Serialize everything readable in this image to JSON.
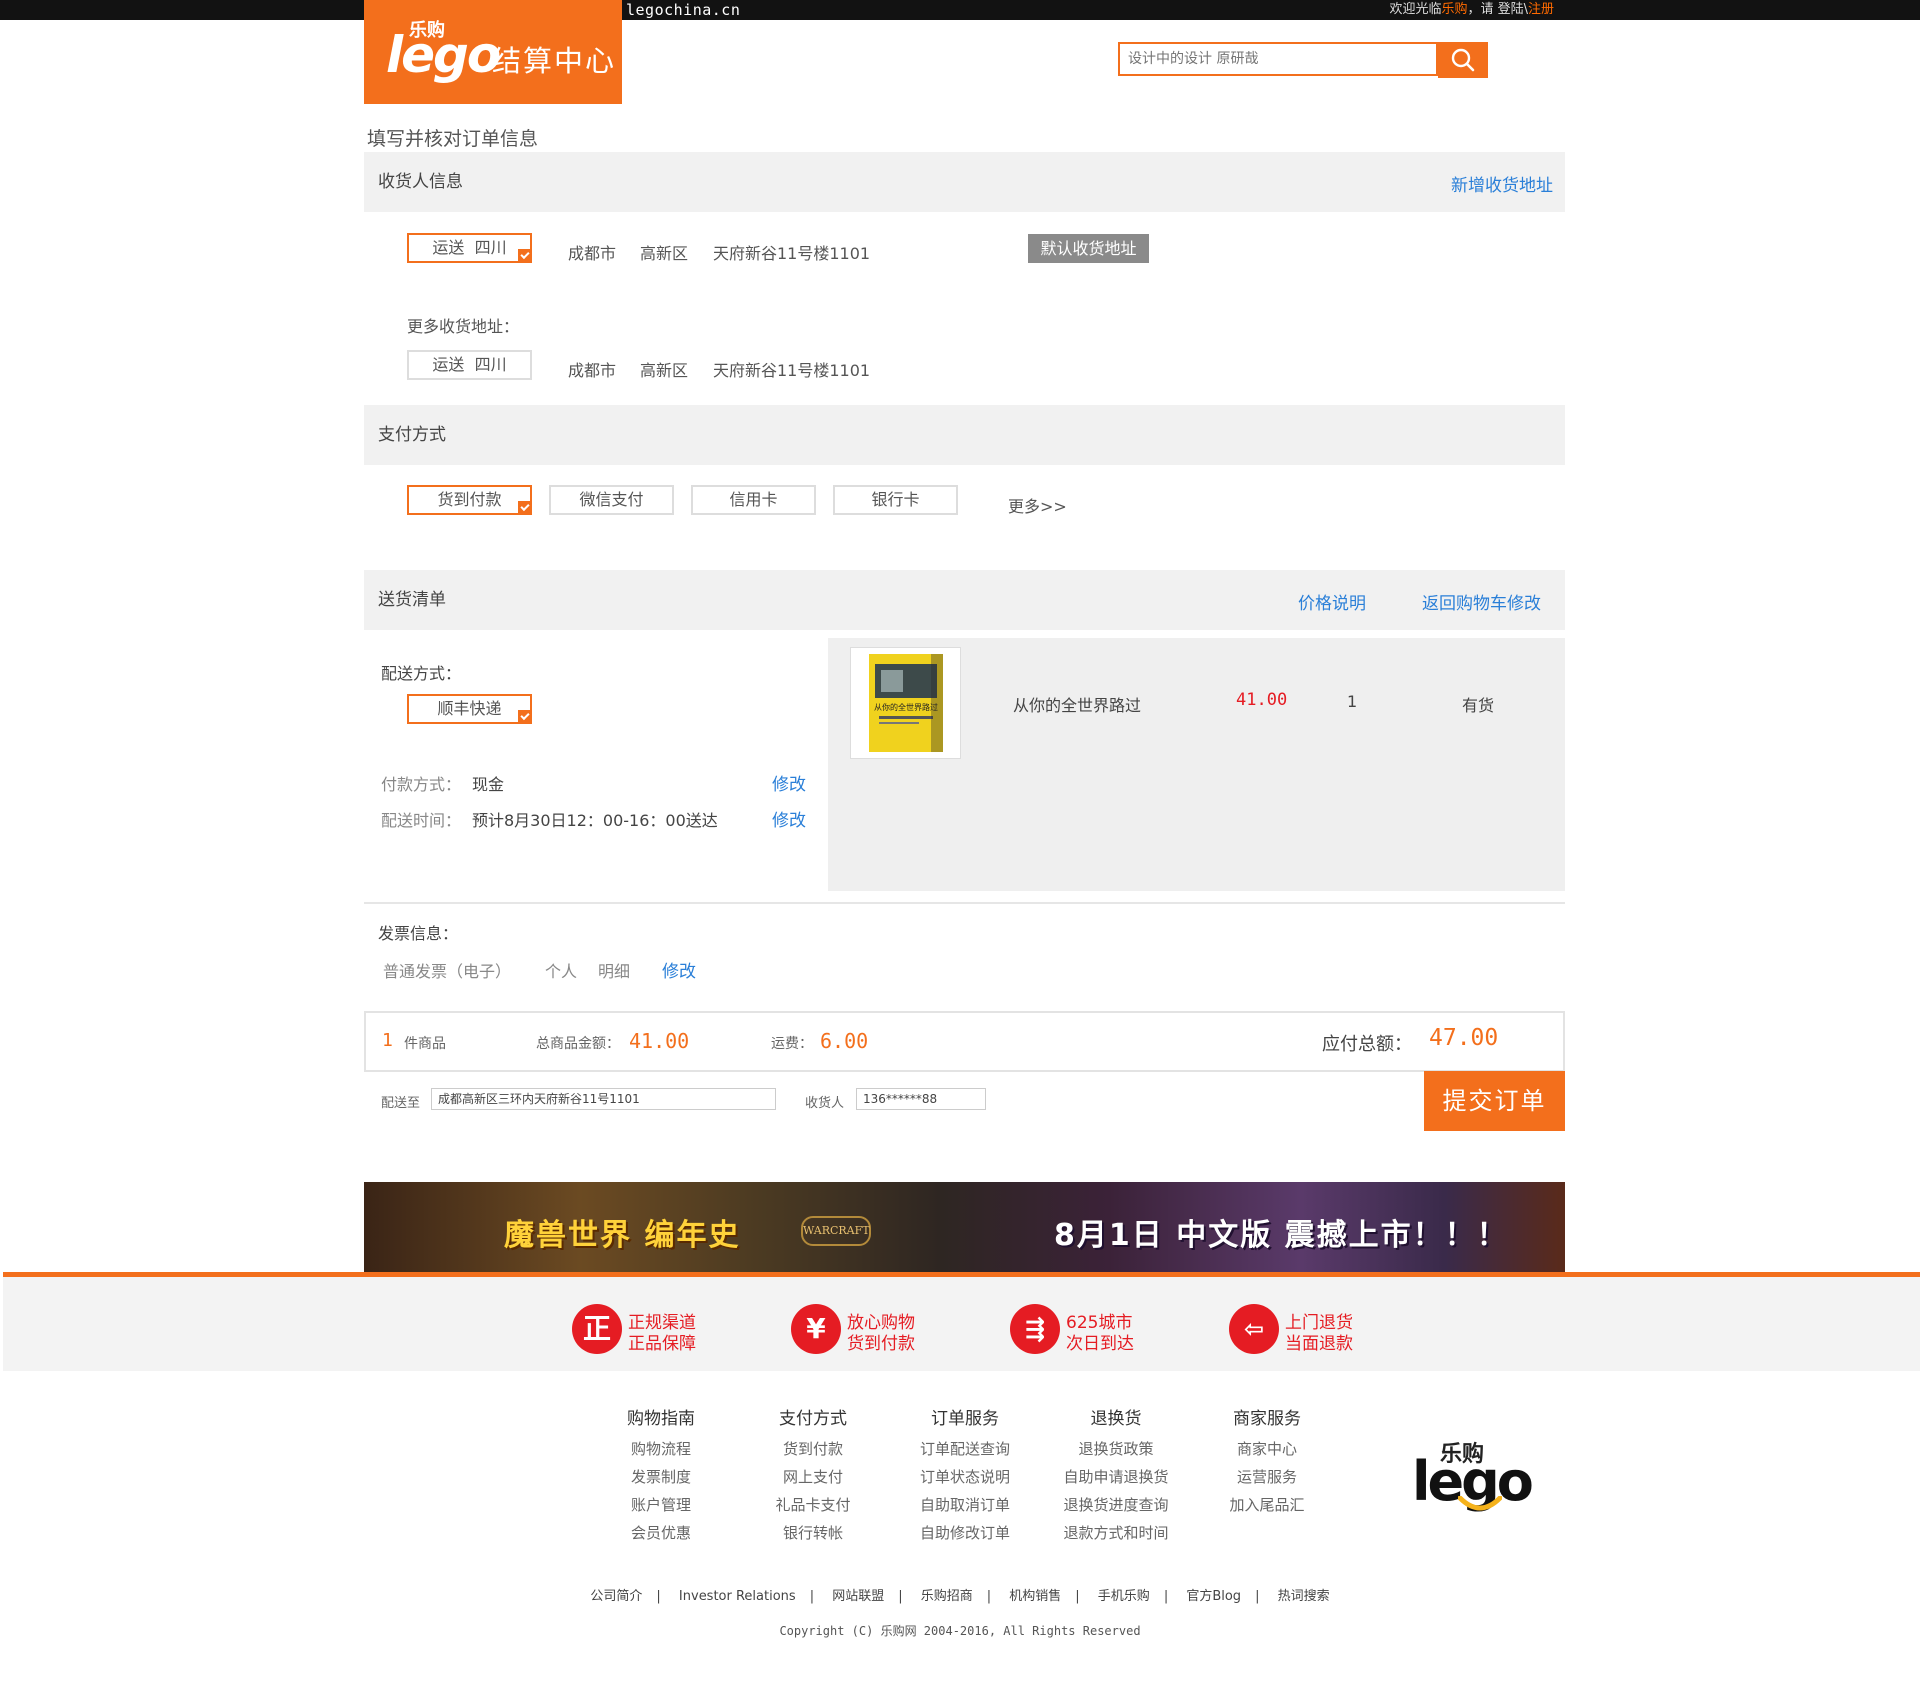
{
  "topbar": {
    "domain": "legochina.cn",
    "welcome_prefix": "欢迎光临",
    "brand": "乐购",
    "welcome_mid": "，请 登陆\\",
    "register": "注册"
  },
  "logo": {
    "legou": "乐购",
    "lego": "lego",
    "title": "结算中心"
  },
  "search": {
    "placeholder": "设计中的设计 原研哉",
    "icon": "search-icon"
  },
  "page_title": "填写并核对订单信息",
  "receiver": {
    "title": "收货人信息",
    "add_link": "新增收货地址",
    "default": {
      "chip": "运送  四川",
      "city": "成都市",
      "district": "高新区",
      "street": "天府新谷11号楼1101",
      "badge": "默认收货地址"
    },
    "more_label": "更多收货地址：",
    "more": {
      "chip": "运送  四川",
      "city": "成都市",
      "district": "高新区",
      "street": "天府新谷11号楼1101"
    }
  },
  "payment": {
    "title": "支付方式",
    "options": [
      "货到付款",
      "微信支付",
      "信用卡",
      "银行卡"
    ],
    "selected": "货到付款",
    "more": "更多>>"
  },
  "delivery": {
    "title": "送货清单",
    "price_note": "价格说明",
    "back_to_cart": "返回购物车修改",
    "method_label": "配送方式：",
    "method": "顺丰快递",
    "pay_label": "付款方式：",
    "pay_value": "现金",
    "time_label": "配送时间：",
    "time_value": "预计8月30日12：00-16：00送达",
    "modify": "修改",
    "item": {
      "cover_title": "从你的全世界路过",
      "name": "从你的全世界路过",
      "price": "41.00",
      "qty": "1",
      "stock": "有货"
    }
  },
  "invoice": {
    "label": "发票信息：",
    "type": "普通发票（电子）",
    "title": "个人",
    "content": "明细",
    "modify": "修改"
  },
  "summary": {
    "count": "1",
    "count_label": "件商品",
    "goods_label": "总商品金额：",
    "goods_amount": "41.00",
    "shipping_label": "运费：",
    "shipping": "6.00",
    "total_label": "应付总额：",
    "total": "47.00"
  },
  "ship_to": {
    "label": "配送至",
    "address": "成都高新区三环内天府新谷11号1101",
    "receiver_label": "收货人",
    "phone": "136******88"
  },
  "submit": "提交订单",
  "banner": {
    "left": "魔兽世界 编年史",
    "logo": "WARCRAFT",
    "right": "8月1日 中文版 震撼上市！！！"
  },
  "features": [
    {
      "icon": "正",
      "l1": "正规渠道",
      "l2": "正品保障"
    },
    {
      "icon": "¥",
      "l1": "放心购物",
      "l2": "货到付款"
    },
    {
      "icon": "⇶",
      "l1": "625城市",
      "l2": "次日到达"
    },
    {
      "icon": "⇦",
      "l1": "上门退货",
      "l2": "当面退款"
    }
  ],
  "footer_cols": [
    {
      "title": "购物指南",
      "items": [
        "购物流程",
        "发票制度",
        "账户管理",
        "会员优惠"
      ]
    },
    {
      "title": "支付方式",
      "items": [
        "货到付款",
        "网上支付",
        "礼品卡支付",
        "银行转帐"
      ]
    },
    {
      "title": "订单服务",
      "items": [
        "订单配送查询",
        "订单状态说明",
        "自助取消订单",
        "自助修改订单"
      ]
    },
    {
      "title": "退换货",
      "items": [
        "退换货政策",
        "自助申请退换货",
        "退换货进度查询",
        "退款方式和时间"
      ]
    },
    {
      "title": "商家服务",
      "items": [
        "商家中心",
        "运营服务",
        "加入尾品汇"
      ]
    }
  ],
  "bottom_links": [
    "公司简介",
    "Investor Relations",
    "网站联盟",
    "乐购招商",
    "机构销售",
    "手机乐购",
    "官方Blog",
    "热词搜索"
  ],
  "copyright": "Copyright (C) 乐购网 2004-2016, All Rights Reserved",
  "colors": {
    "accent": "#f36f1c",
    "link": "#2a7fd8",
    "price": "#e51c23"
  }
}
